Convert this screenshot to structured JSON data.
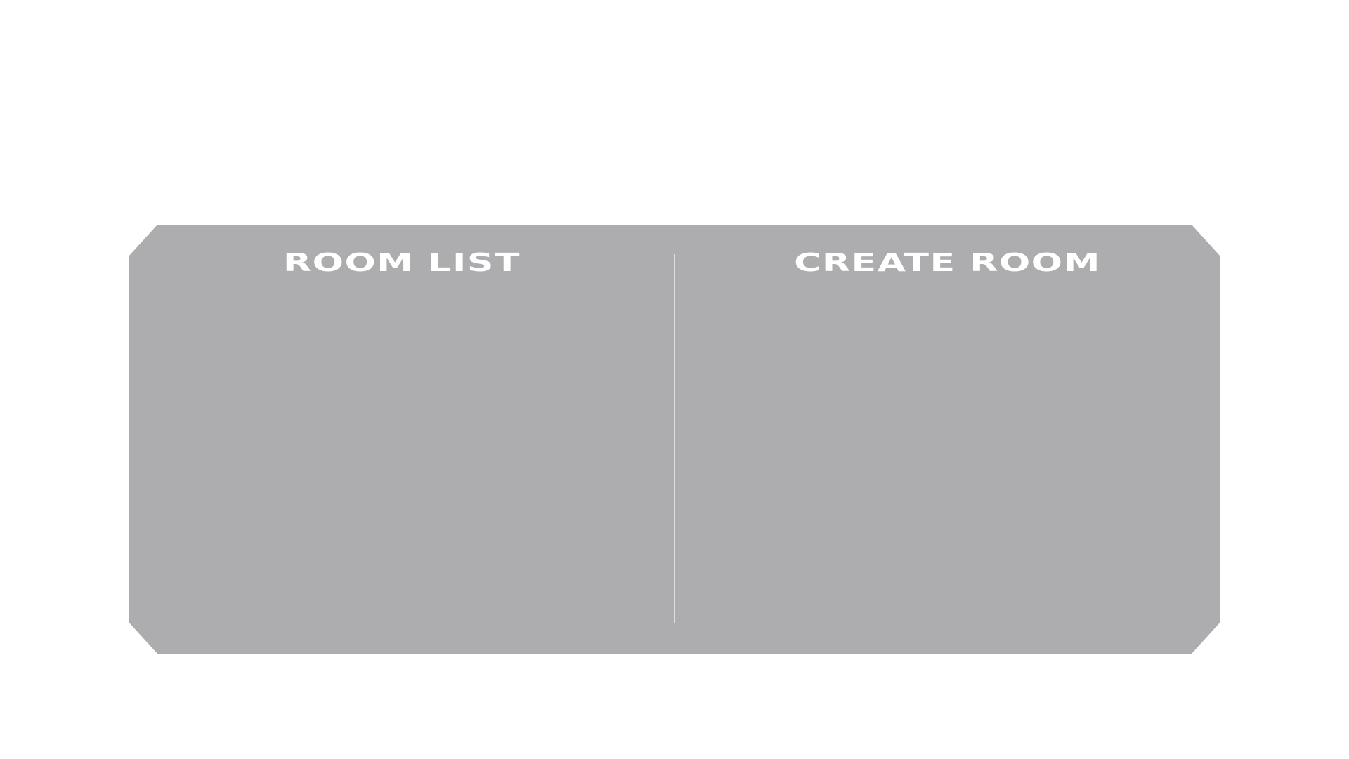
{
  "colors": {
    "background": "#ffffff",
    "panel": "#adadaf",
    "title_text": "#ffffff",
    "divider": "#e6e6e8"
  },
  "room_list": {
    "title": "ROOM LIST"
  },
  "create_room": {
    "title": "CREATE ROOM"
  }
}
